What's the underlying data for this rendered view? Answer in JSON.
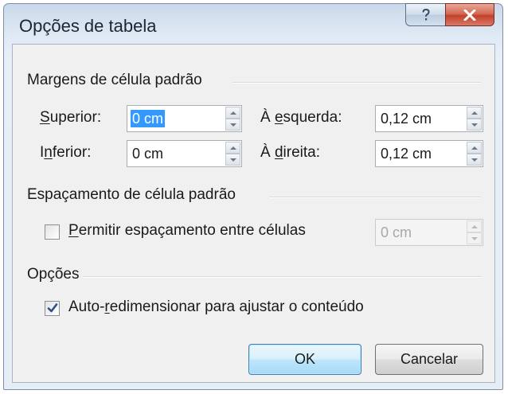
{
  "dialog": {
    "title": "Opções de tabela",
    "help_icon": "question-mark-icon",
    "close_icon": "close-x-icon"
  },
  "margins": {
    "group_label": "Margens de célula padrão",
    "top": {
      "label_pre": "",
      "label_mnemonic": "S",
      "label_post": "uperior:",
      "value": "0 cm"
    },
    "left": {
      "label_pre": "À ",
      "label_mnemonic": "e",
      "label_post": "squerda:",
      "value": "0,12 cm"
    },
    "bottom": {
      "label_pre": "I",
      "label_mnemonic": "n",
      "label_post": "ferior:",
      "value": "0 cm"
    },
    "right": {
      "label_pre": "À ",
      "label_mnemonic": "d",
      "label_post": "ireita:",
      "value": "0,12 cm"
    }
  },
  "spacing": {
    "group_label": "Espaçamento de célula padrão",
    "allow": {
      "label_pre": "",
      "label_mnemonic": "P",
      "label_post": "ermitir espaçamento entre células",
      "checked": false
    },
    "value": "0 cm"
  },
  "options": {
    "group_label": "Opções",
    "autoresize": {
      "label_pre": "Auto-",
      "label_mnemonic": "r",
      "label_post": "edimensionar para ajustar o conteúdo",
      "checked": true
    }
  },
  "buttons": {
    "ok": "OK",
    "cancel": "Cancelar"
  },
  "colors": {
    "selection": "#3399ff",
    "close_button": "#c2412a",
    "default_button_border": "#3c7fb1"
  }
}
